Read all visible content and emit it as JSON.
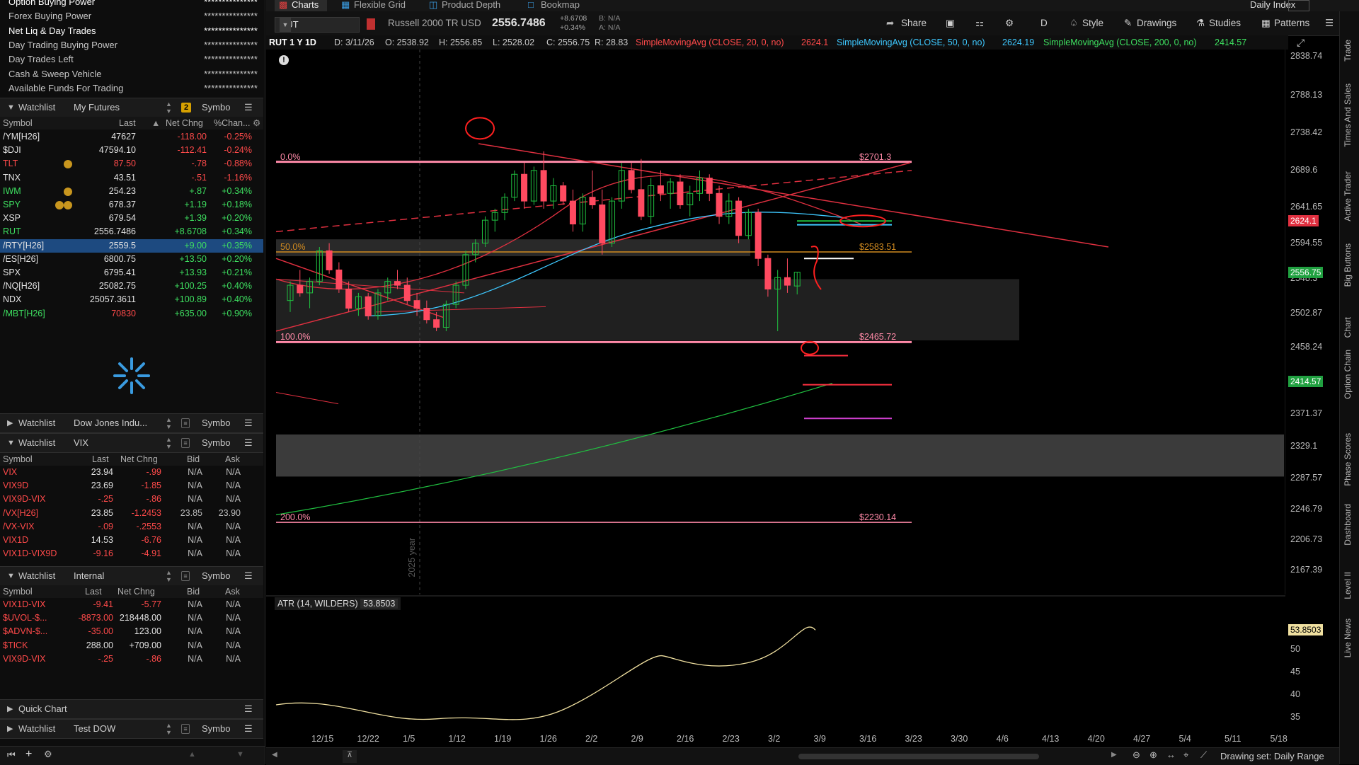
{
  "account": {
    "rows": [
      {
        "label": "Option Buying Power",
        "value": "***************"
      },
      {
        "label": "Forex Buying Power",
        "value": "***************"
      },
      {
        "label": "Net Liq & Day Trades",
        "value": "***************"
      },
      {
        "label": "Day Trading Buying Power",
        "value": "***************"
      },
      {
        "label": "Day Trades Left",
        "value": "***************"
      },
      {
        "label": "Cash & Sweep Vehicle",
        "value": "***************"
      },
      {
        "label": "Available Funds For Trading",
        "value": "***************"
      }
    ]
  },
  "watchlist1": {
    "title": "Watchlist",
    "name": "My Futures",
    "badge": "2",
    "symbol_label": "Symbo",
    "columns": [
      "Symbol",
      "Last",
      "Net Chng",
      "%Chan..."
    ],
    "rows": [
      {
        "s": "/YM[H26]",
        "last": "47627",
        "chg": "-118.00",
        "pct": "-0.25%",
        "dir": "neg"
      },
      {
        "s": "$DJI",
        "last": "47594.10",
        "chg": "-112.41",
        "pct": "-0.24%",
        "dir": "neg"
      },
      {
        "s": "TLT",
        "last": "87.50",
        "chg": "-.78",
        "pct": "-0.88%",
        "dir": "neg"
      },
      {
        "s": "TNX",
        "last": "43.51",
        "chg": "-.51",
        "pct": "-1.16%",
        "dir": "neg"
      },
      {
        "s": "IWM",
        "last": "254.23",
        "chg": "+.87",
        "pct": "+0.34%",
        "dir": "pos"
      },
      {
        "s": "SPY",
        "last": "678.37",
        "chg": "+1.19",
        "pct": "+0.18%",
        "dir": "pos"
      },
      {
        "s": "XSP",
        "last": "679.54",
        "chg": "+1.39",
        "pct": "+0.20%",
        "dir": "pos"
      },
      {
        "s": "RUT",
        "last": "2556.7486",
        "chg": "+8.6708",
        "pct": "+0.34%",
        "dir": "pos"
      },
      {
        "s": "/RTY[H26]",
        "last": "2559.5",
        "chg": "+9.00",
        "pct": "+0.35%",
        "dir": "pos"
      },
      {
        "s": "/ES[H26]",
        "last": "6800.75",
        "chg": "+13.50",
        "pct": "+0.20%",
        "dir": "pos"
      },
      {
        "s": "SPX",
        "last": "6795.41",
        "chg": "+13.93",
        "pct": "+0.21%",
        "dir": "pos"
      },
      {
        "s": "/NQ[H26]",
        "last": "25082.75",
        "chg": "+100.25",
        "pct": "+0.40%",
        "dir": "pos"
      },
      {
        "s": "NDX",
        "last": "25057.3611",
        "chg": "+100.89",
        "pct": "+0.40%",
        "dir": "pos"
      },
      {
        "s": "/MBT[H26]",
        "last": "70830",
        "chg": "+635.00",
        "pct": "+0.90%",
        "dir": "pos"
      }
    ]
  },
  "watchlist2": {
    "title": "Watchlist",
    "name": "Dow Jones Indu...",
    "symbol_label": "Symbo"
  },
  "watchlist3": {
    "title": "Watchlist",
    "name": "VIX",
    "symbol_label": "Symbo",
    "columns": [
      "Symbol",
      "Last",
      "Net Chng",
      "Bid",
      "Ask"
    ],
    "rows": [
      {
        "s": "VIX",
        "last": "23.94",
        "chg": "-.99",
        "bid": "N/A",
        "ask": "N/A",
        "dir": "neg"
      },
      {
        "s": "VIX9D",
        "last": "23.69",
        "chg": "-1.85",
        "bid": "N/A",
        "ask": "N/A",
        "dir": "neg"
      },
      {
        "s": "VIX9D-VIX",
        "last": "-.25",
        "chg": "-.86",
        "bid": "N/A",
        "ask": "N/A",
        "dir": "neg"
      },
      {
        "s": "/VX[H26]",
        "last": "23.85",
        "chg": "-1.2453",
        "bid": "23.85",
        "ask": "23.90",
        "dir": "neg"
      },
      {
        "s": "/VX-VIX",
        "last": "-.09",
        "chg": "-.2553",
        "bid": "N/A",
        "ask": "N/A",
        "dir": "neg"
      },
      {
        "s": "VIX1D",
        "last": "14.53",
        "chg": "-6.76",
        "bid": "N/A",
        "ask": "N/A",
        "dir": "neg"
      },
      {
        "s": "VIX1D-VIX9D",
        "last": "-9.16",
        "chg": "-4.91",
        "bid": "N/A",
        "ask": "N/A",
        "dir": "neg"
      }
    ]
  },
  "watchlist4": {
    "title": "Watchlist",
    "name": "Internal",
    "symbol_label": "Symbo",
    "columns": [
      "Symbol",
      "Last",
      "Net Chng",
      "Bid",
      "Ask"
    ],
    "rows": [
      {
        "s": "VIX1D-VIX",
        "last": "-9.41",
        "chg": "-5.77",
        "bid": "N/A",
        "ask": "N/A",
        "dir": "neg"
      },
      {
        "s": "$UVOL-$...",
        "last": "-8873.00",
        "chg": "218448.00",
        "bid": "N/A",
        "ask": "N/A",
        "dir": "neg"
      },
      {
        "s": "$ADVN-$...",
        "last": "-35.00",
        "chg": "123.00",
        "bid": "N/A",
        "ask": "N/A",
        "dir": "neg"
      },
      {
        "s": "$TICK",
        "last": "288.00",
        "chg": "+709.00",
        "bid": "N/A",
        "ask": "N/A",
        "dir": "neg"
      },
      {
        "s": "VIX9D-VIX",
        "last": "-.25",
        "chg": "-.86",
        "bid": "N/A",
        "ask": "N/A",
        "dir": "neg"
      }
    ]
  },
  "quick_chart": {
    "label": "Quick Chart"
  },
  "watchlist5": {
    "title": "Watchlist",
    "name": "Test DOW",
    "symbol_label": "Symbo"
  },
  "tabs": [
    {
      "label": "Charts",
      "active": true
    },
    {
      "label": "Flexible Grid",
      "active": false
    },
    {
      "label": "Product Depth",
      "active": false
    },
    {
      "label": "Bookmap",
      "active": false
    }
  ],
  "top_right": {
    "label": "Daily Index"
  },
  "toolbar": {
    "symbol": "RUT",
    "description": "Russell 2000 TR USD",
    "price": "2556.7486",
    "change": "+8.6708",
    "change_pct": "+0.34%",
    "bid": "B: N/A",
    "ask": "A: N/A",
    "share": "Share",
    "period": "D",
    "style": "Style",
    "drawings": "Drawings",
    "studies": "Studies",
    "patterns": "Patterns"
  },
  "study_bar": {
    "name": "RUT 1 Y 1D",
    "date": "D: 3/11/26",
    "open": "O: 2538.92",
    "high": "H: 2556.85",
    "low": "L: 2528.02",
    "close": "C: 2556.75",
    "range": "R: 28.83",
    "sma20": "SimpleMovingAvg (CLOSE, 20, 0, no)",
    "sma20_val": "2624.1",
    "sma50": "SimpleMovingAvg (CLOSE, 50, 0, no)",
    "sma50_val": "2624.19",
    "sma200": "SimpleMovingAvg (CLOSE, 200, 0, no)",
    "sma200_val": "2414.57"
  },
  "chart_data": {
    "type": "candlestick",
    "price_axis": [
      "2838.74",
      "2788.13",
      "2738.42",
      "2689.6",
      "2641.65",
      "2594.55",
      "2548.3",
      "2502.87",
      "2458.24",
      "2414.57",
      "2371.37",
      "2329.1",
      "2287.57",
      "2246.79",
      "2206.73",
      "2167.39"
    ],
    "price_badges": [
      {
        "value": "2624.1",
        "color": "#e03040"
      },
      {
        "value": "2556.75",
        "color": "#20a040"
      },
      {
        "value": "2414.57",
        "color": "#20a040"
      }
    ],
    "fib_levels": [
      {
        "pct": "0.0%",
        "price": "$2701.3"
      },
      {
        "pct": "50.0%",
        "price": "$2583.51"
      },
      {
        "pct": "100.0%",
        "price": "$2465.72"
      },
      {
        "pct": "200.0%",
        "price": "$2230.14"
      }
    ],
    "x_axis": [
      "12/15",
      "12/22",
      "1/5",
      "1/12",
      "1/19",
      "1/26",
      "2/2",
      "2/9",
      "2/16",
      "2/23",
      "3/2",
      "3/9",
      "3/16",
      "3/23",
      "3/30",
      "4/6",
      "4/13",
      "4/20",
      "4/27",
      "5/4",
      "5/11",
      "5/18"
    ],
    "year_marker": "2025 year",
    "candles": [
      [
        2520,
        2545,
        2505,
        2540
      ],
      [
        2540,
        2560,
        2525,
        2530
      ],
      [
        2530,
        2550,
        2510,
        2545
      ],
      [
        2545,
        2590,
        2540,
        2585
      ],
      [
        2585,
        2595,
        2555,
        2560
      ],
      [
        2560,
        2570,
        2530,
        2535
      ],
      [
        2535,
        2545,
        2505,
        2510
      ],
      [
        2510,
        2530,
        2500,
        2525
      ],
      [
        2525,
        2530,
        2495,
        2500
      ],
      [
        2500,
        2535,
        2495,
        2530
      ],
      [
        2530,
        2550,
        2520,
        2545
      ],
      [
        2545,
        2560,
        2535,
        2540
      ],
      [
        2540,
        2550,
        2515,
        2520
      ],
      [
        2520,
        2530,
        2500,
        2510
      ],
      [
        2510,
        2520,
        2490,
        2495
      ],
      [
        2495,
        2505,
        2480,
        2485
      ],
      [
        2485,
        2520,
        2480,
        2515
      ],
      [
        2515,
        2545,
        2510,
        2540
      ],
      [
        2540,
        2585,
        2535,
        2580
      ],
      [
        2580,
        2600,
        2570,
        2595
      ],
      [
        2595,
        2630,
        2590,
        2625
      ],
      [
        2625,
        2640,
        2610,
        2635
      ],
      [
        2635,
        2660,
        2625,
        2655
      ],
      [
        2655,
        2690,
        2650,
        2685
      ],
      [
        2685,
        2700,
        2640,
        2650
      ],
      [
        2650,
        2695,
        2645,
        2690
      ],
      [
        2690,
        2715,
        2640,
        2650
      ],
      [
        2650,
        2680,
        2640,
        2670
      ],
      [
        2670,
        2675,
        2645,
        2650
      ],
      [
        2650,
        2665,
        2610,
        2620
      ],
      [
        2620,
        2660,
        2610,
        2655
      ],
      [
        2655,
        2690,
        2640,
        2645
      ],
      [
        2645,
        2665,
        2580,
        2595
      ],
      [
        2595,
        2655,
        2590,
        2650
      ],
      [
        2650,
        2700,
        2640,
        2690
      ],
      [
        2690,
        2700,
        2660,
        2665
      ],
      [
        2665,
        2705,
        2625,
        2630
      ],
      [
        2630,
        2680,
        2620,
        2670
      ],
      [
        2670,
        2690,
        2650,
        2660
      ],
      [
        2660,
        2680,
        2640,
        2675
      ],
      [
        2675,
        2685,
        2640,
        2645
      ],
      [
        2645,
        2670,
        2630,
        2660
      ],
      [
        2660,
        2690,
        2650,
        2680
      ],
      [
        2680,
        2685,
        2650,
        2660
      ],
      [
        2660,
        2670,
        2620,
        2630
      ],
      [
        2630,
        2660,
        2620,
        2650
      ],
      [
        2650,
        2655,
        2595,
        2605
      ],
      [
        2605,
        2640,
        2600,
        2635
      ],
      [
        2635,
        2640,
        2565,
        2575
      ],
      [
        2575,
        2580,
        2525,
        2535
      ],
      [
        2535,
        2560,
        2480,
        2550
      ],
      [
        2550,
        2575,
        2530,
        2540
      ],
      [
        2539,
        2557,
        2528,
        2557
      ]
    ],
    "atr": {
      "label": "ATR (14, WILDERS)",
      "value": "53.8503",
      "axis": [
        "50",
        "45",
        "40",
        "35"
      ]
    }
  },
  "right_rail": [
    "Trade",
    "Times And Sales",
    "Active Trader",
    "Big Buttons",
    "Chart",
    "Option Chain",
    "Phase Scores",
    "Dashboard",
    "Level II",
    "Live News"
  ],
  "status": {
    "text": "Drawing set: Daily Range"
  }
}
